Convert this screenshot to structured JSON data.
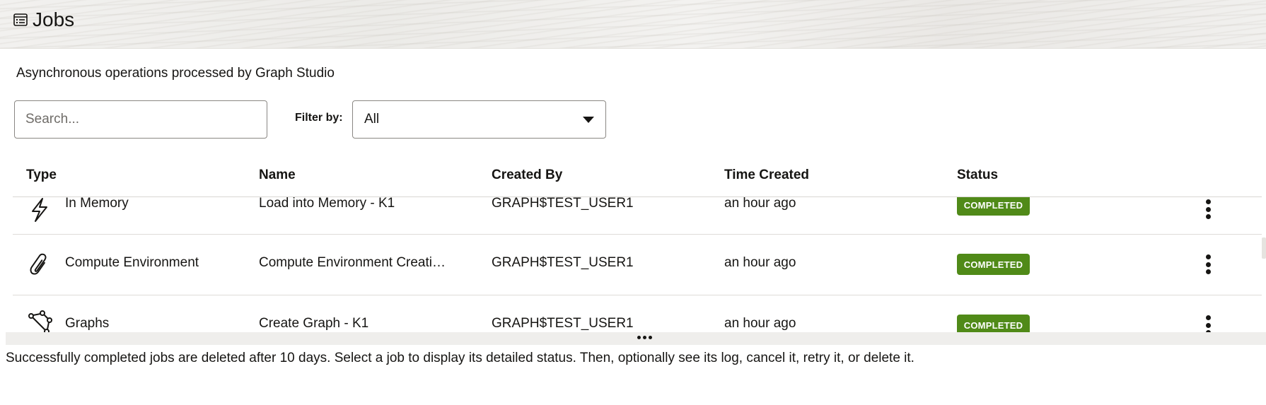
{
  "header": {
    "title": "Jobs",
    "icon": "jobs-list-icon"
  },
  "subtitle": "Asynchronous operations processed by Graph Studio",
  "search": {
    "placeholder": "Search...",
    "value": ""
  },
  "filter": {
    "label": "Filter by:",
    "selected": "All"
  },
  "table": {
    "columns": [
      "Type",
      "Name",
      "Created By",
      "Time Created",
      "Status"
    ],
    "rows": [
      {
        "type_icon": "lightning-icon",
        "type": "In Memory",
        "name": "Load into Memory - K1",
        "created_by": "GRAPH$TEST_USER1",
        "time_created": "an hour ago",
        "status": "COMPLETED"
      },
      {
        "type_icon": "paperclip-icon",
        "type": "Compute Environment",
        "name": "Compute Environment Creati…",
        "created_by": "GRAPH$TEST_USER1",
        "time_created": "an hour ago",
        "status": "COMPLETED"
      },
      {
        "type_icon": "graph-nodes-icon",
        "type": "Graphs",
        "name": "Create Graph - K1",
        "created_by": "GRAPH$TEST_USER1",
        "time_created": "an hour ago",
        "status": "COMPLETED"
      }
    ]
  },
  "colors": {
    "status_completed": "#508a18",
    "text": "#161513"
  },
  "footer_note": "Successfully completed jobs are deleted after 10 days. Select a job to display its detailed status. Then, optionally see its log, cancel it, retry it, or delete it."
}
